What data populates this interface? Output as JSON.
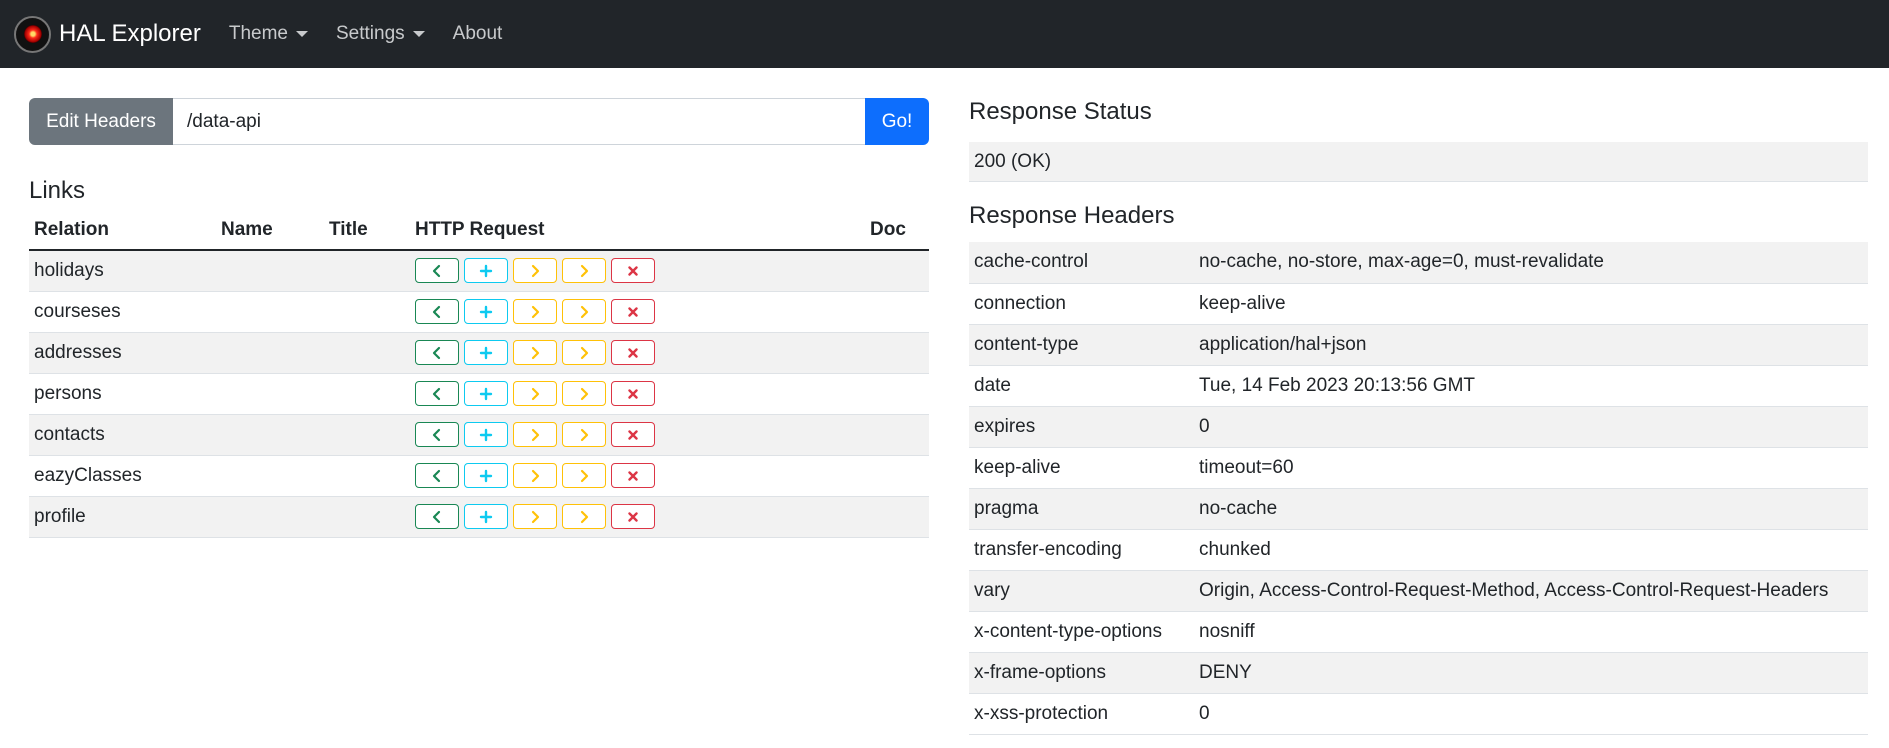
{
  "navbar": {
    "brand": "HAL Explorer",
    "menu": [
      {
        "label": "Theme",
        "dropdown": true
      },
      {
        "label": "Settings",
        "dropdown": true
      },
      {
        "label": "About",
        "dropdown": false
      }
    ]
  },
  "request": {
    "edit_headers_label": "Edit Headers",
    "url_value": "/data-api",
    "go_label": "Go!"
  },
  "links": {
    "title": "Links",
    "columns": {
      "relation": "Relation",
      "name": "Name",
      "title": "Title",
      "http": "HTTP Request",
      "doc": "Doc"
    },
    "rows": [
      {
        "relation": "holidays",
        "name": "",
        "title": "",
        "doc": ""
      },
      {
        "relation": "courseses",
        "name": "",
        "title": "",
        "doc": ""
      },
      {
        "relation": "addresses",
        "name": "",
        "title": "",
        "doc": ""
      },
      {
        "relation": "persons",
        "name": "",
        "title": "",
        "doc": ""
      },
      {
        "relation": "contacts",
        "name": "",
        "title": "",
        "doc": ""
      },
      {
        "relation": "eazyClasses",
        "name": "",
        "title": "",
        "doc": ""
      },
      {
        "relation": "profile",
        "name": "",
        "title": "",
        "doc": ""
      }
    ],
    "http_buttons": [
      {
        "method": "GET",
        "icon": "chevron-left-icon",
        "color": "#198754"
      },
      {
        "method": "POST",
        "icon": "plus-icon",
        "color": "#0dcaf0"
      },
      {
        "method": "PUT",
        "icon": "chevron-right-icon",
        "color": "#ffc107"
      },
      {
        "method": "PATCH",
        "icon": "chevron-right-icon",
        "color": "#ffc107"
      },
      {
        "method": "DELETE",
        "icon": "x-icon",
        "color": "#dc3545"
      }
    ]
  },
  "response_status": {
    "title": "Response Status",
    "value": "200 (OK)"
  },
  "response_headers": {
    "title": "Response Headers",
    "rows": [
      {
        "key": "cache-control",
        "value": "no-cache, no-store, max-age=0, must-revalidate"
      },
      {
        "key": "connection",
        "value": "keep-alive"
      },
      {
        "key": "content-type",
        "value": "application/hal+json"
      },
      {
        "key": "date",
        "value": "Tue, 14 Feb 2023 20:13:56 GMT"
      },
      {
        "key": "expires",
        "value": "0"
      },
      {
        "key": "keep-alive",
        "value": "timeout=60"
      },
      {
        "key": "pragma",
        "value": "no-cache"
      },
      {
        "key": "transfer-encoding",
        "value": "chunked"
      },
      {
        "key": "vary",
        "value": "Origin, Access-Control-Request-Method, Access-Control-Request-Headers"
      },
      {
        "key": "x-content-type-options",
        "value": "nosniff"
      },
      {
        "key": "x-frame-options",
        "value": "DENY"
      },
      {
        "key": "x-xss-protection",
        "value": "0"
      }
    ]
  },
  "colors": {
    "navbar_bg": "#212529",
    "go_button": "#0d6efd",
    "edit_headers_button": "#6c757d",
    "stripe": "#f2f2f2"
  }
}
